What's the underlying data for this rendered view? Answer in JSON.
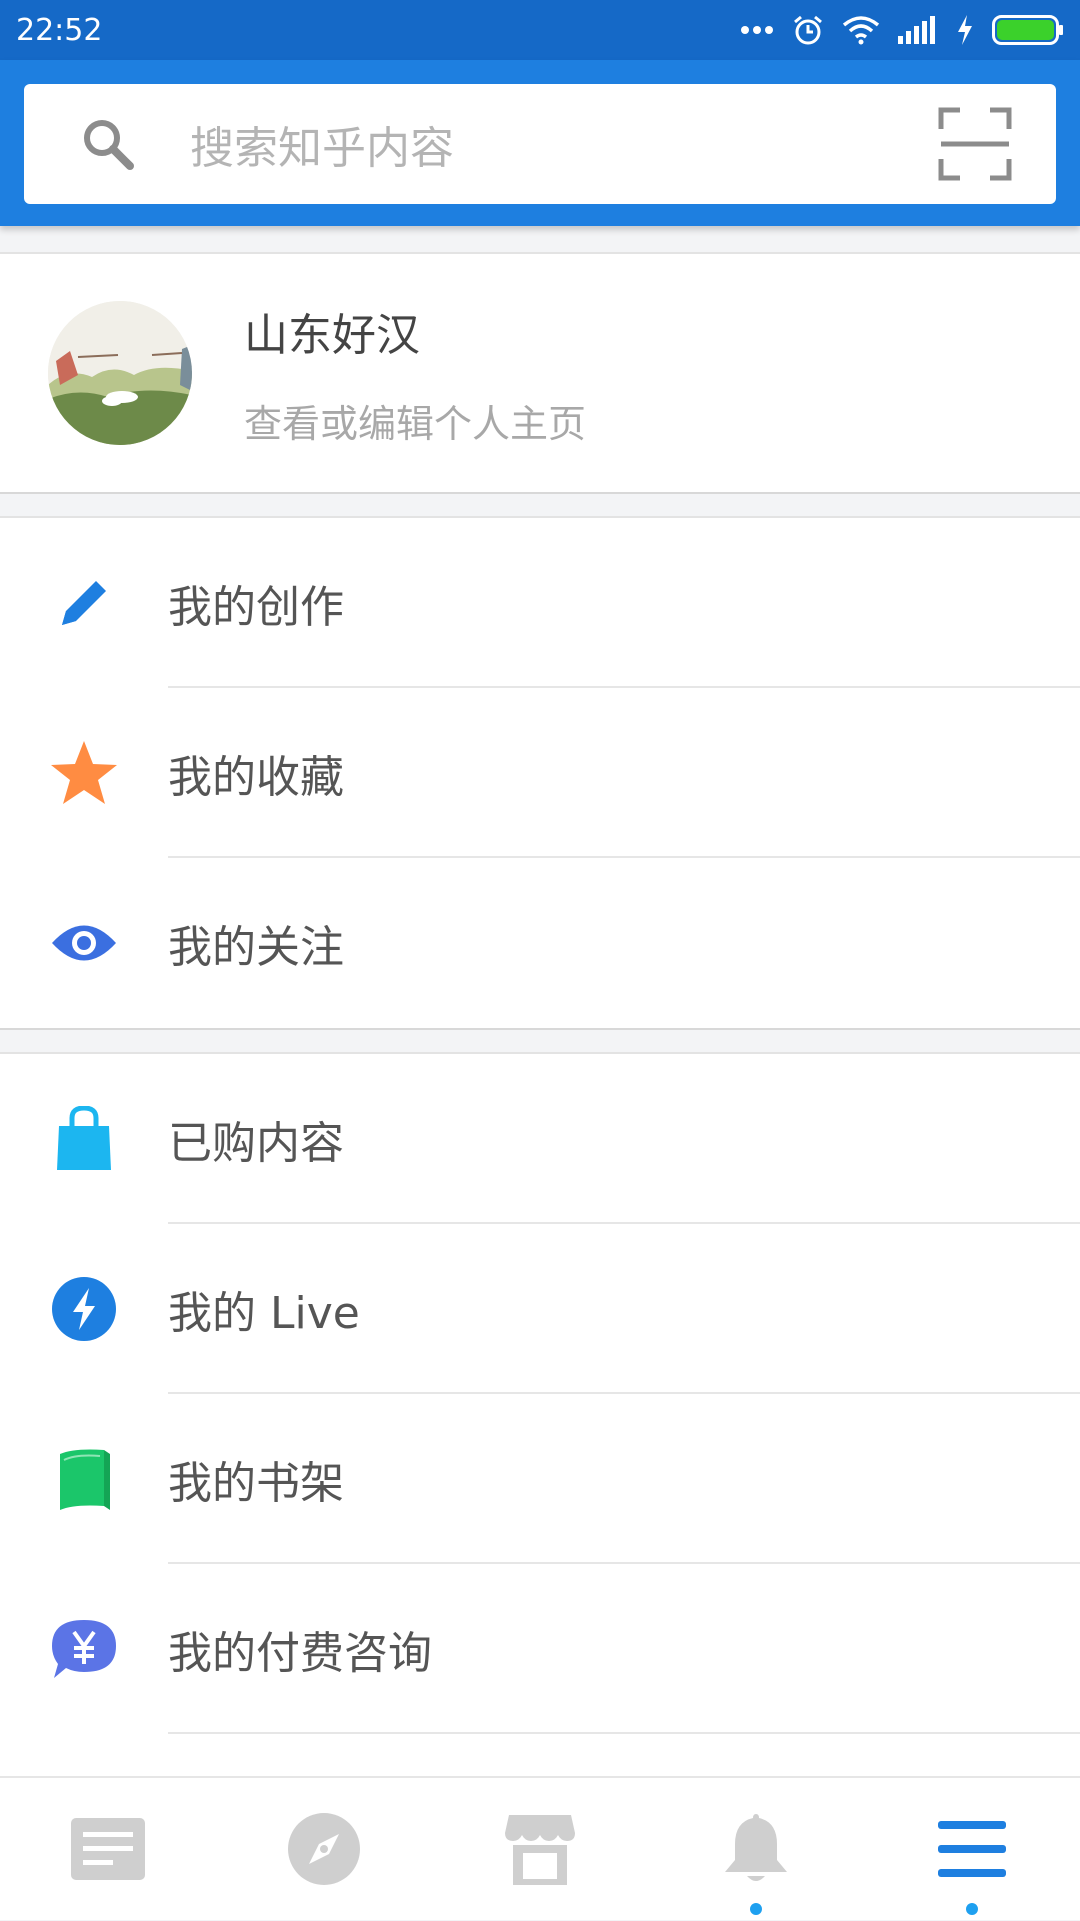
{
  "status_bar": {
    "time": "22:52"
  },
  "search": {
    "placeholder": "搜索知乎内容"
  },
  "profile": {
    "name": "山东好汉",
    "subtitle": "查看或编辑个人主页"
  },
  "menu_group_1": [
    {
      "label": "我的创作",
      "icon": "pencil-icon",
      "color": "#1e7fe0"
    },
    {
      "label": "我的收藏",
      "icon": "star-icon",
      "color": "#ff8c42"
    },
    {
      "label": "我的关注",
      "icon": "eye-icon",
      "color": "#3b6fe0"
    }
  ],
  "menu_group_2": [
    {
      "label": "已购内容",
      "icon": "shopping-bag-icon",
      "color": "#1cb6f0"
    },
    {
      "label": "我的 Live",
      "icon": "lightning-icon",
      "color": "#1e7fe0"
    },
    {
      "label": "我的书架",
      "icon": "book-icon",
      "color": "#1bc66a"
    },
    {
      "label": "我的付费咨询",
      "icon": "yuan-chat-icon",
      "color": "#5b74e6"
    }
  ],
  "tabs": [
    {
      "icon": "feed-icon",
      "active": false,
      "dot": false
    },
    {
      "icon": "compass-icon",
      "active": false,
      "dot": false
    },
    {
      "icon": "store-icon",
      "active": false,
      "dot": false
    },
    {
      "icon": "bell-icon",
      "active": false,
      "dot": true
    },
    {
      "icon": "menu-icon",
      "active": true,
      "dot": true
    }
  ],
  "colors": {
    "header": "#1e7fe0",
    "status_bar": "#1569c7",
    "active_tab": "#1e7fe0",
    "inactive_tab": "#cfcfcf"
  }
}
